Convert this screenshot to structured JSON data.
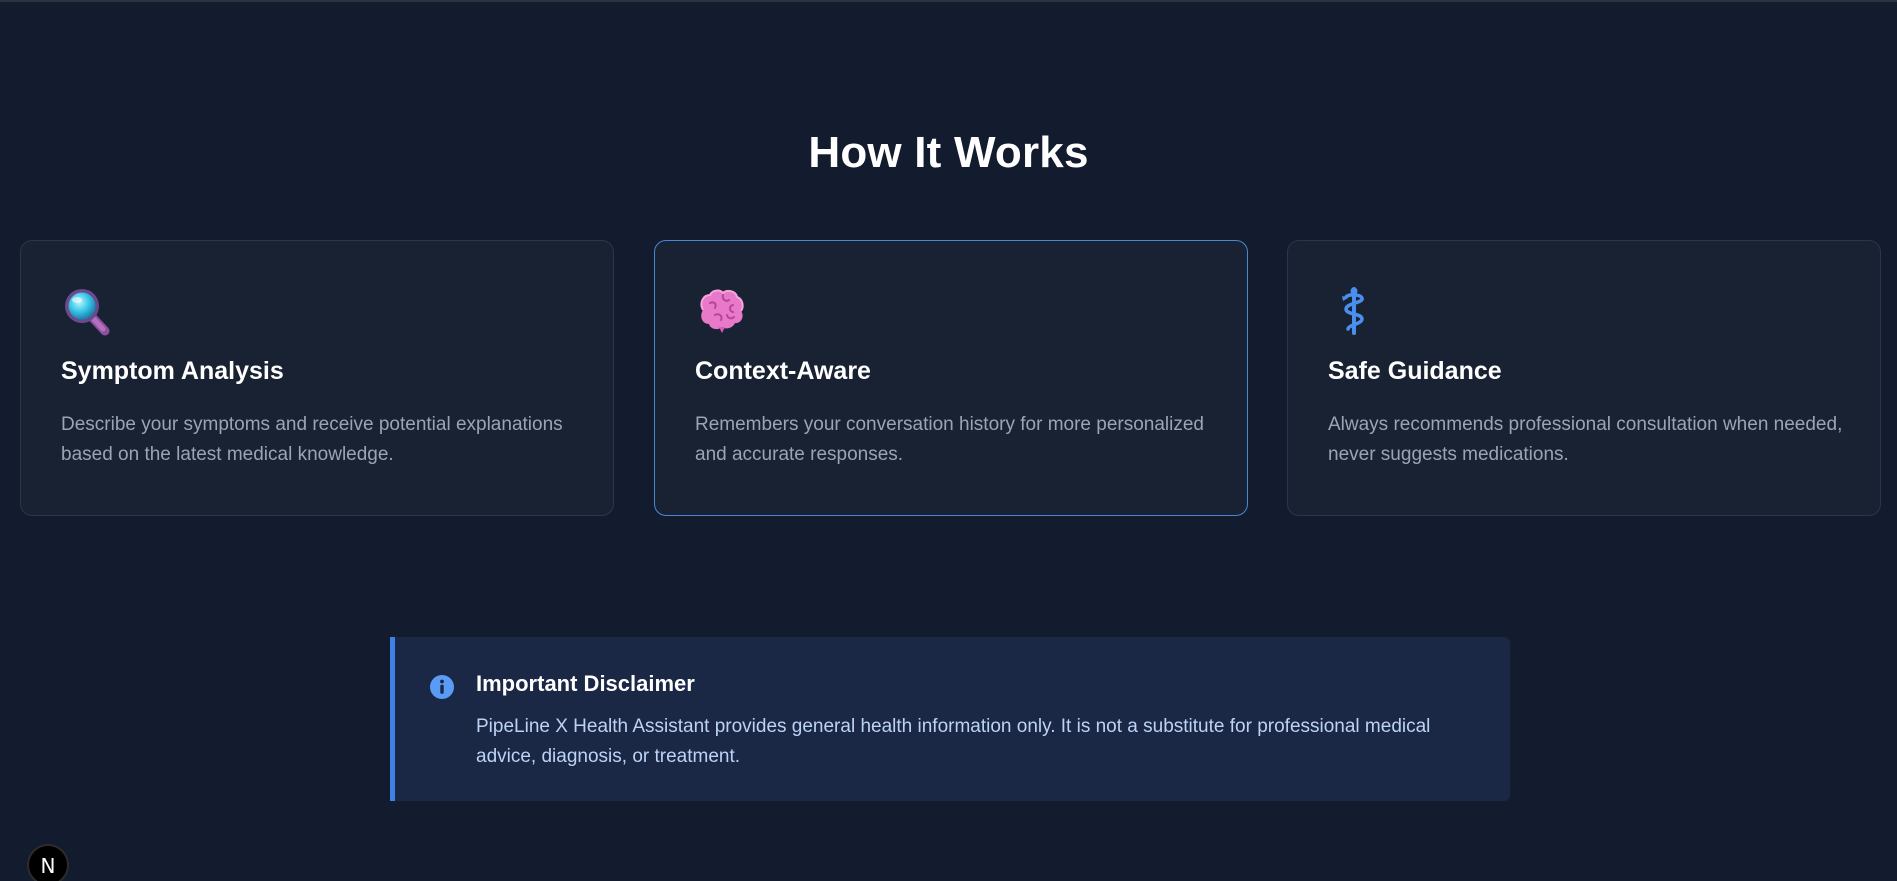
{
  "section": {
    "title": "How It Works"
  },
  "cards": [
    {
      "icon": "magnifying-glass-icon",
      "title": "Symptom Analysis",
      "description": "Describe your symptoms and receive potential explanations based on the latest medical knowledge."
    },
    {
      "icon": "brain-icon",
      "title": "Context-Aware",
      "description": "Remembers your conversation history for more personalized and accurate responses.",
      "highlighted": true
    },
    {
      "icon": "medical-symbol-icon",
      "title": "Safe Guidance",
      "description": "Always recommends professional consultation when needed, never suggests medications."
    }
  ],
  "disclaimer": {
    "icon": "info-icon",
    "title": "Important Disclaimer",
    "text": "PipeLine X Health Assistant provides general health information only. It is not a substitute for professional medical advice, diagnosis, or treatment."
  },
  "dev_badge": {
    "label": "N",
    "icon": "nextjs-icon"
  },
  "colors": {
    "background": "#131c2e",
    "card_bg": "#182233",
    "card_border": "#2b3648",
    "highlight_border": "#4a86d6",
    "disclaimer_bg": "#1a2745",
    "disclaimer_accent": "#3f82e6",
    "muted_text": "#9aa4b5"
  }
}
